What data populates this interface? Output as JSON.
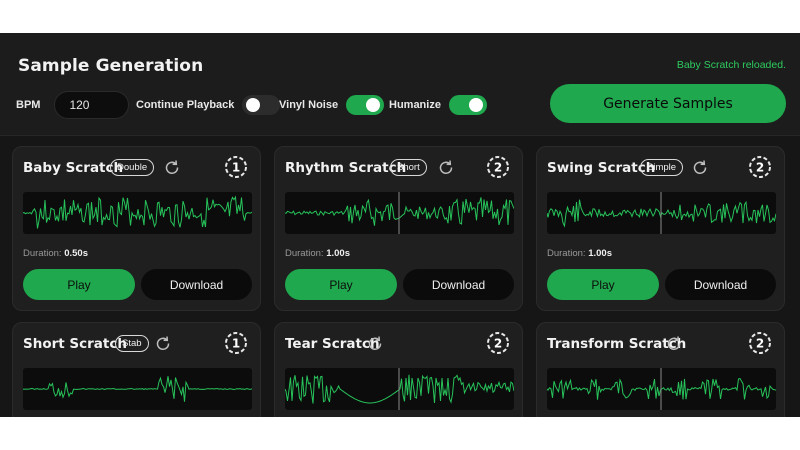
{
  "header": {
    "title": "Sample Generation",
    "status": "Baby Scratch reloaded."
  },
  "controls": {
    "bpm_label": "BPM",
    "bpm_value": "120",
    "continue_playback": {
      "label": "Continue Playback",
      "on": false
    },
    "vinyl_noise": {
      "label": "Vinyl Noise",
      "on": true
    },
    "humanize": {
      "label": "Humanize",
      "on": true
    },
    "generate_label": "Generate Samples"
  },
  "colors": {
    "accent": "#1fa84d",
    "background": "#161616",
    "card": "#1f1f1f"
  },
  "cards": [
    {
      "title": "Baby Scratch",
      "badge": "Double",
      "count": "1",
      "duration_label": "Duration:",
      "duration": "0.50s",
      "play_label": "Play",
      "download_label": "Download"
    },
    {
      "title": "Rhythm Scratch",
      "badge": "Short",
      "count": "2",
      "duration_label": "Duration:",
      "duration": "1.00s",
      "play_label": "Play",
      "download_label": "Download"
    },
    {
      "title": "Swing Scratch",
      "badge": "Simple",
      "count": "2",
      "duration_label": "Duration:",
      "duration": "1.00s",
      "play_label": "Play",
      "download_label": "Download"
    },
    {
      "title": "Short Scratch",
      "badge": "Stab",
      "count": "1"
    },
    {
      "title": "Tear Scratch",
      "count": "2"
    },
    {
      "title": "Transform Scratch",
      "count": "2"
    }
  ]
}
